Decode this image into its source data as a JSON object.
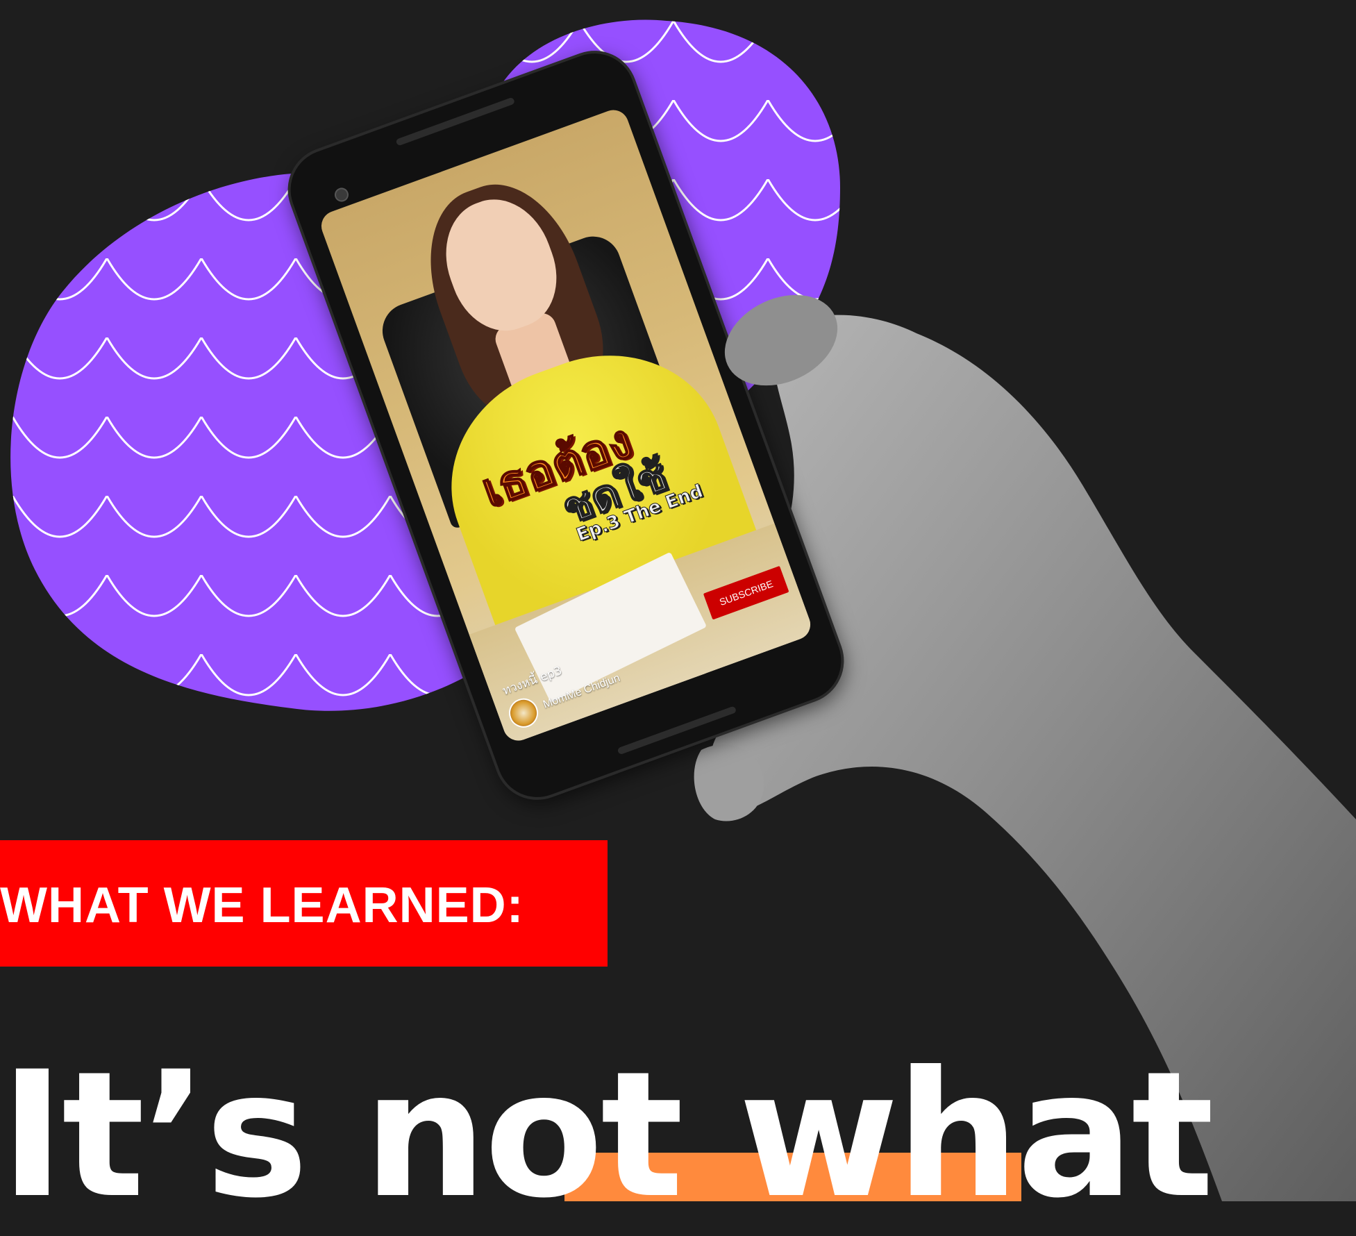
{
  "section_label": "WHAT WE LEARNED:",
  "headline": {
    "part1": "It’s not ",
    "part2": "what"
  },
  "phone": {
    "video_overlay_line1": "เธอต้อง",
    "video_overlay_line2": "ชดใช้",
    "video_overlay_line3": "Ep.3 The End",
    "video_title": "ทวงหนี้ ep3",
    "channel_name": "MomMe Chidjun",
    "subscribe_label": "SUBSCRIBE"
  },
  "colors": {
    "background": "#1e1e1e",
    "blob": "#9650ff",
    "label_red": "#ff0000",
    "highlight_orange": "#ff8a3d",
    "subscribe_red": "#cc0000"
  }
}
